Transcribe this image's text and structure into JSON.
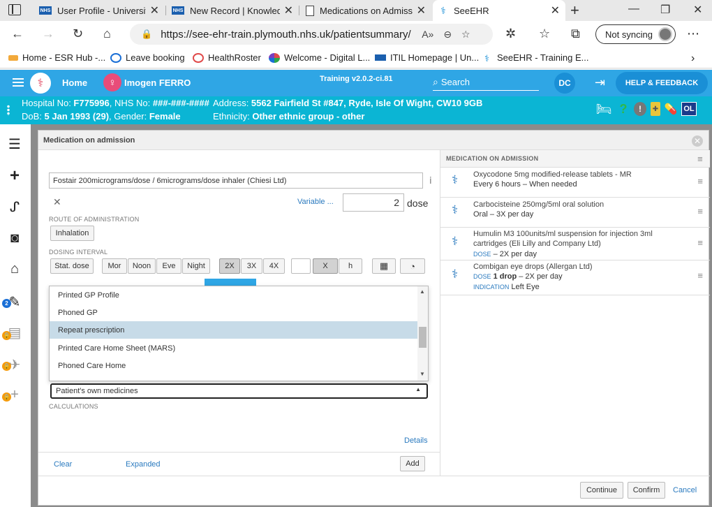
{
  "browser": {
    "tabs": [
      {
        "title": "User Profile - University",
        "favicon": "NHS"
      },
      {
        "title": "New Record | Knowledg",
        "favicon": "NHS"
      },
      {
        "title": "Medications on Admiss",
        "favicon": "doc"
      },
      {
        "title": "SeeEHR",
        "favicon": "seeehr"
      }
    ],
    "url": "https://see-ehr-train.plymouth.nhs.uk/patientsummary/...",
    "sync_label": "Not syncing",
    "bookmarks": [
      {
        "label": "Home - ESR Hub -...",
        "color": "#f2a93b"
      },
      {
        "label": "Leave booking",
        "color": "#1a6fd6"
      },
      {
        "label": "HealthRoster",
        "color": "#e04a4a"
      },
      {
        "label": "Welcome - Digital L...",
        "color": "#7a3fbf"
      },
      {
        "label": "ITIL Homepage | Un...",
        "color": "#1b5fae"
      },
      {
        "label": "SeeEHR - Training E...",
        "color": "#1a8fd6"
      }
    ]
  },
  "app": {
    "home": "Home",
    "patient_name": "Imogen FERRO",
    "training": "Training v2.0.2-ci.81",
    "search": "Search",
    "user_initials": "DC",
    "help": "HELP & FEEDBACK"
  },
  "banner": {
    "l1_pre": "Hospital No: ",
    "hosp_no": "F775996",
    "l1_mid": ", NHS No: ",
    "nhs_no": "###-###-####",
    "l2_pre": "DoB: ",
    "dob": "5 Jan 1993 (29)",
    "l2_mid": ", Gender: ",
    "gender": "Female",
    "r1_pre": "Address: ",
    "address": "5562 Fairfield St #847, Ryde, Isle Of Wight, CW10 9GB",
    "r2_pre": "Ethnicity: ",
    "ethnicity": "Other ethnic group - other",
    "ol": "OL"
  },
  "leftnav": {
    "badge_count": "2"
  },
  "modal": {
    "title": "Medication on admission",
    "drug": "Fostair 200micrograms/dose / 6micrograms/dose inhaler (Chiesi Ltd)",
    "variable": "Variable ...",
    "dose_value": "2",
    "dose_unit": "dose",
    "route_label": "ROUTE OF ADMINISTRATION",
    "route_value": "Inhalation",
    "dosing_label": "DOSING INTERVAL",
    "dosing_buttons": [
      "Stat. dose",
      "Mor",
      "Noon",
      "Eve",
      "Night"
    ],
    "freq_buttons": [
      "2X",
      "3X",
      "4X"
    ],
    "freq_selected": "2X",
    "x_label": "X",
    "h_label": "h",
    "dropdown_options": [
      "Printed GP Profile",
      "Phoned GP",
      "Repeat prescription",
      "Printed Care Home Sheet (MARS)",
      "Phoned Care Home"
    ],
    "dropdown_highlight": "Repeat prescription",
    "source_selected": "Patient's own medicines",
    "calculations_label": "CALCULATIONS",
    "details": "Details",
    "clear": "Clear",
    "expanded": "Expanded",
    "add": "Add"
  },
  "right": {
    "header": "MEDICATION ON ADMISSION",
    "meds": [
      {
        "name": "Oxycodone 5mg modified-release tablets - MR",
        "sub": "Every 6 hours – When needed"
      },
      {
        "name": "Carbocisteine 250mg/5ml oral solution",
        "sub": "Oral – 3X per day"
      },
      {
        "name": "Humulin M3 100units/ml suspension for injection 3ml cartridges (Eli Lilly and Company Ltd)",
        "dose_key": "DOSE",
        "dose": " – 2X per day"
      },
      {
        "name": "Combigan eye drops (Allergan Ltd)",
        "dose_key": "DOSE",
        "dose_bold": "1 drop",
        "dose": " – 2X per day",
        "ind_key": "INDICATION",
        "ind": "Left Eye"
      }
    ]
  },
  "footer": {
    "continue": "Continue",
    "confirm": "Confirm",
    "cancel": "Cancel"
  }
}
